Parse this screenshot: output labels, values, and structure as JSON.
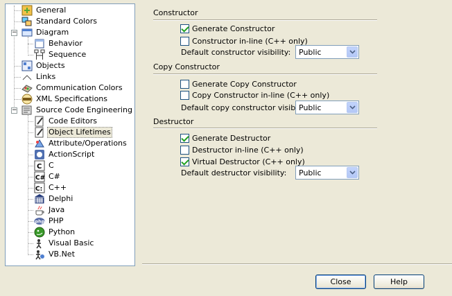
{
  "tree": {
    "items": [
      {
        "label": "General",
        "icon": "general-icon"
      },
      {
        "label": "Standard Colors",
        "icon": "standard-colors-icon"
      },
      {
        "label": "Diagram",
        "icon": "diagram-icon"
      },
      {
        "label": "Behavior",
        "icon": "behavior-icon"
      },
      {
        "label": "Sequence",
        "icon": "sequence-icon"
      },
      {
        "label": "Objects",
        "icon": "objects-icon"
      },
      {
        "label": "Links",
        "icon": "links-icon"
      },
      {
        "label": "Communication Colors",
        "icon": "communication-colors-icon"
      },
      {
        "label": "XML Specifications",
        "icon": "xml-icon"
      },
      {
        "label": "Source Code Engineering",
        "icon": "source-code-icon"
      },
      {
        "label": "Code Editors",
        "icon": "code-editors-icon"
      },
      {
        "label": "Object Lifetimes",
        "icon": "object-lifetimes-icon"
      },
      {
        "label": "Attribute/Operations",
        "icon": "attribute-operations-icon"
      },
      {
        "label": "ActionScript",
        "icon": "actionscript-icon"
      },
      {
        "label": "C",
        "icon": "c-language-icon"
      },
      {
        "label": "C#",
        "icon": "csharp-icon"
      },
      {
        "label": "C++",
        "icon": "cpp-icon"
      },
      {
        "label": "Delphi",
        "icon": "delphi-icon"
      },
      {
        "label": "Java",
        "icon": "java-icon"
      },
      {
        "label": "PHP",
        "icon": "php-icon"
      },
      {
        "label": "Python",
        "icon": "python-icon"
      },
      {
        "label": "Visual Basic",
        "icon": "visual-basic-icon"
      },
      {
        "label": "VB.Net",
        "icon": "vbnet-icon"
      }
    ],
    "selected": "Object Lifetimes",
    "expander_glyph": "−"
  },
  "constructor": {
    "title": "Constructor",
    "generate_label": "Generate Constructor",
    "generate_checked": true,
    "inline_label": "Constructor in-line (C++ only)",
    "inline_checked": false,
    "visibility_label": "Default constructor visibility:",
    "visibility_value": "Public"
  },
  "copy_constructor": {
    "title": "Copy Constructor",
    "generate_label": "Generate Copy Constructor",
    "generate_checked": false,
    "inline_label": "Copy Constructor in-line (C++ only)",
    "inline_checked": false,
    "visibility_label": "Default copy constructor visibility:",
    "visibility_value": "Public"
  },
  "destructor": {
    "title": "Destructor",
    "generate_label": "Generate Destructor",
    "generate_checked": true,
    "inline_label": "Destructor in-line (C++ only)",
    "inline_checked": false,
    "virtual_label": "Virtual Destructor (C++ only)",
    "virtual_checked": true,
    "visibility_label": "Default destructor visibility:",
    "visibility_value": "Public"
  },
  "buttons": {
    "close": "Close",
    "help": "Help"
  },
  "colors": {
    "window_bg": "#ece9d8",
    "check_mark": "#21a121",
    "input_border": "#7f9db9",
    "button_border": "#003c74"
  }
}
